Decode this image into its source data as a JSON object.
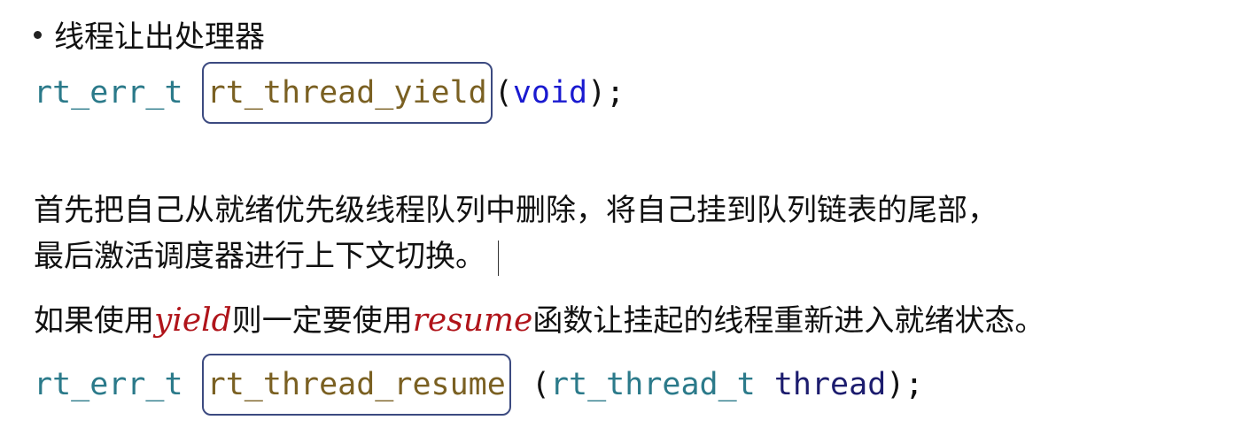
{
  "bullet": {
    "text": "线程让出处理器"
  },
  "code_yield": {
    "return_type": "rt_err_t",
    "function_name": "rt_thread_yield",
    "open_paren": "(",
    "param": "void",
    "close": ");"
  },
  "description": {
    "line1": "首先把自己从就绪优先级线程队列中删除，将自己挂到队列链表的尾部，",
    "line2": "最后激活调度器进行上下文切换。"
  },
  "note": {
    "prefix": "如果使用",
    "yield_word": "yield",
    "middle": "则一定要使用",
    "resume_word": "resume",
    "suffix": "函数让挂起的线程重新进入就绪状态。"
  },
  "code_resume": {
    "return_type": "rt_err_t",
    "function_name": "rt_thread_resume",
    "open_paren": "(",
    "param_type": "rt_thread_t",
    "param_name": "thread",
    "close": ");"
  },
  "colors": {
    "type": "#2b7a8a",
    "function": "#7a6022",
    "keyword": "#1a1ad0",
    "param": "#1c1c6e",
    "highlight_word": "#b0141a",
    "box_border": "#3c4a80"
  }
}
